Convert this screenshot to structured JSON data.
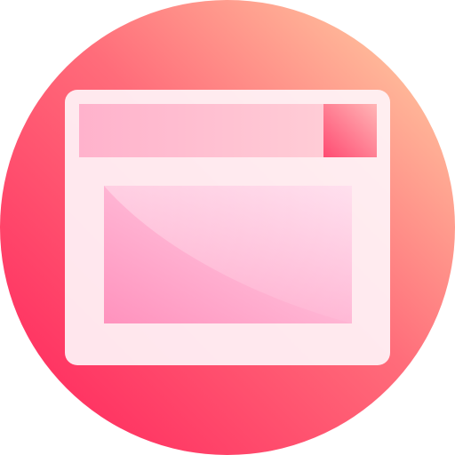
{
  "icon": {
    "name": "browser-window-icon",
    "colors": {
      "circle_start": "#ff2c5f",
      "circle_end": "#ffc59e",
      "window_frame": "#fff3f8",
      "title_bar_start": "#ffb2cc",
      "title_bar_end": "#ffd2d8",
      "title_button_start": "#ff4b72",
      "title_button_end": "#ffb6b6",
      "content_start": "#ff92bd",
      "content_end": "#ffd8ea"
    }
  }
}
